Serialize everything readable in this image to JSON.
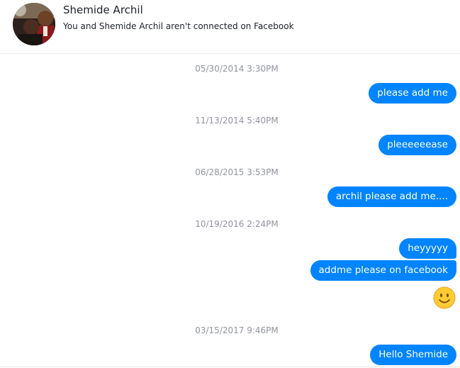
{
  "header": {
    "contact_name": "Shemide Archil",
    "status_text": "You and Shemide Archil aren't connected on Facebook",
    "avatar_icon": "profile-photo"
  },
  "conversation": {
    "bubble_color": "#0084ff",
    "timestamps": [
      "05/30/2014 3:30PM",
      "11/13/2014 5:40PM",
      "06/28/2015 3:53PM",
      "10/19/2016 2:24PM",
      "03/15/2017 9:46PM"
    ],
    "messages": [
      "please add me",
      "pleeeeeease",
      "archil please add me....",
      "heyyyyy",
      "addme please on facebook",
      "Hello Shemide"
    ],
    "emoji_icon": "smiley-face"
  }
}
